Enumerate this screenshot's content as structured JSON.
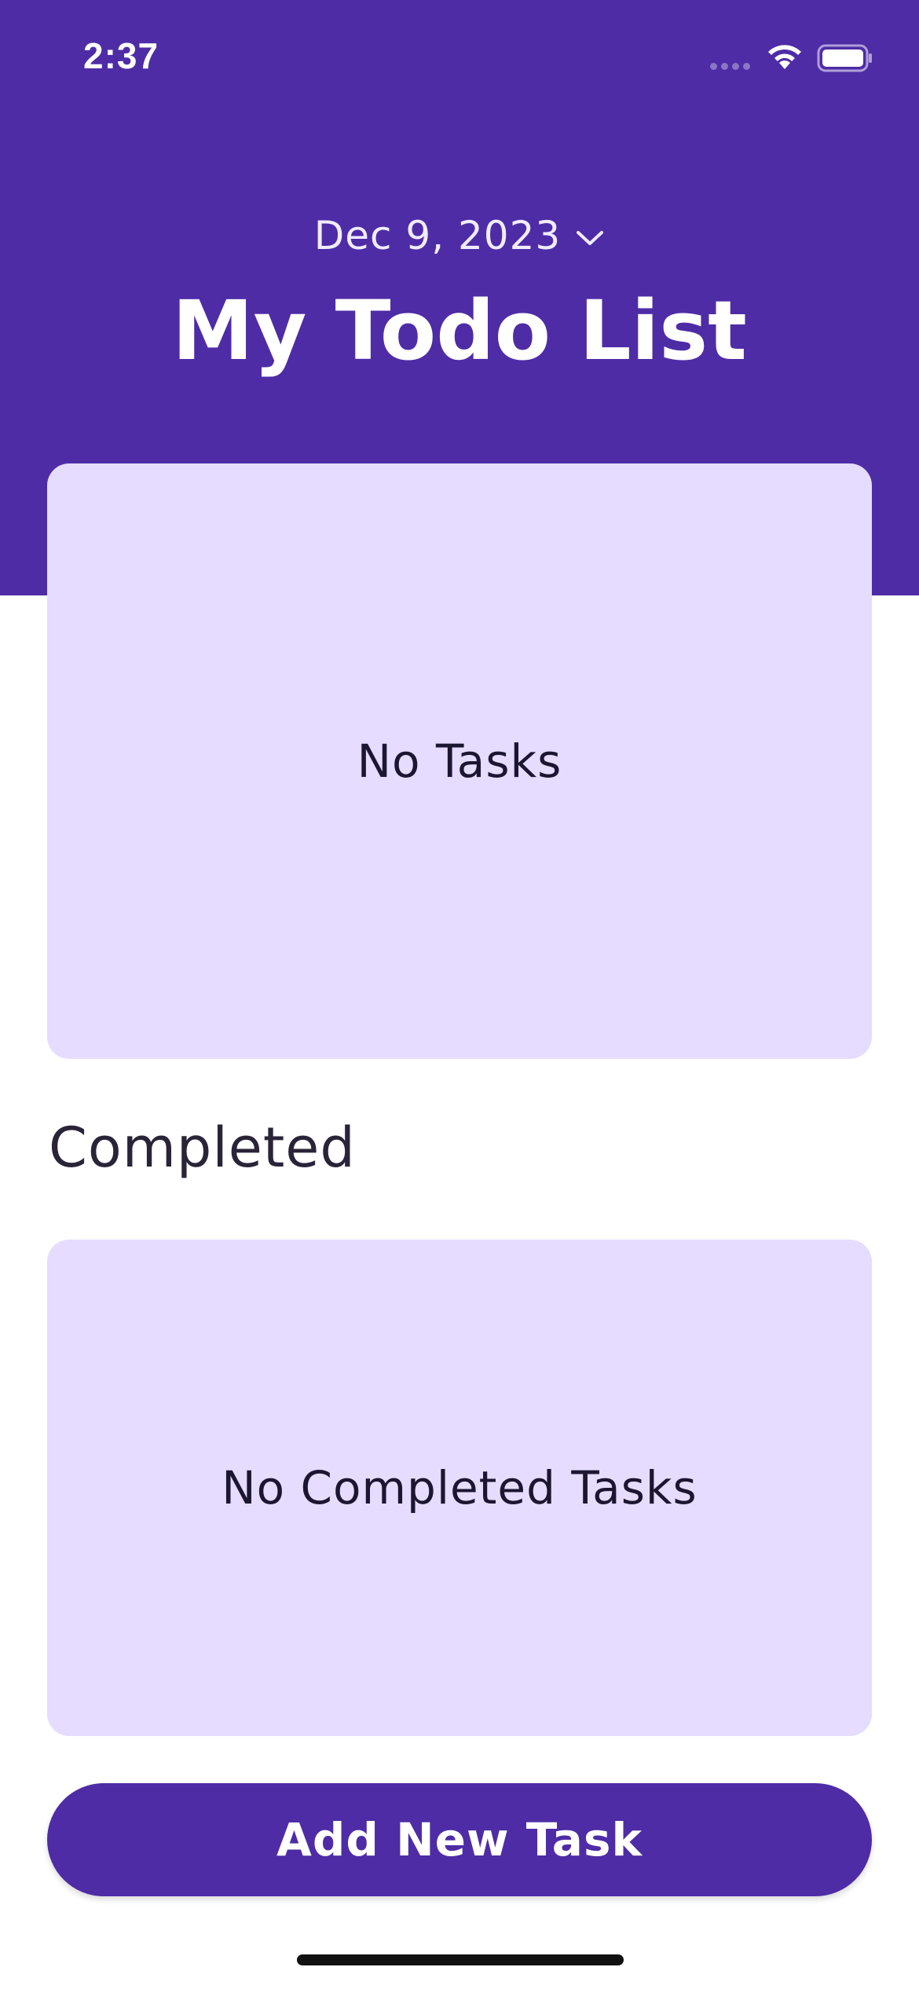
{
  "status_bar": {
    "time": "2:37",
    "icons": [
      "signal-icon",
      "wifi-icon",
      "battery-icon"
    ]
  },
  "header": {
    "date": "Dec 9, 2023",
    "date_icon": "chevron-down-icon",
    "title": "My Todo List"
  },
  "tasks_card": {
    "empty_text": "No Tasks"
  },
  "completed_section": {
    "title": "Completed",
    "empty_text": "No Completed Tasks"
  },
  "actions": {
    "add_label": "Add New Task"
  },
  "colors": {
    "primary": "#4e2ca6",
    "card_background": "#e6dcff",
    "text_dark": "#1c1630",
    "background": "#ffffff"
  }
}
